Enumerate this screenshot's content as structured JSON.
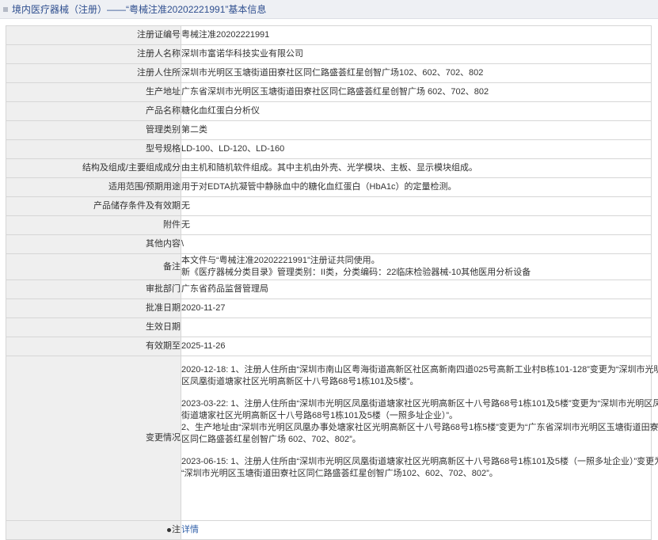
{
  "header": {
    "title": "境内医疗器械（注册）——“粤械注准20202221991”基本信息"
  },
  "rows": {
    "reg_no": {
      "label": "注册证编号",
      "value": "粤械注准20202221991"
    },
    "registrant": {
      "label": "注册人名称",
      "value": "深圳市富诺华科技实业有限公司"
    },
    "reg_address": {
      "label": "注册人住所",
      "value": "深圳市光明区玉塘街道田寮社区同仁路盛荟红星创智广场102、602、702、802"
    },
    "prod_address": {
      "label": "生产地址",
      "value": "广东省深圳市光明区玉塘街道田寮社区同仁路盛荟红星创智广场 602、702、802"
    },
    "product_name": {
      "label": "产品名称",
      "value": "糖化血红蛋白分析仪"
    },
    "category": {
      "label": "管理类别",
      "value": "第二类"
    },
    "model": {
      "label": "型号规格",
      "value": "LD-100、LD-120、LD-160"
    },
    "structure": {
      "label": "结构及组成/主要组成成分",
      "value": "由主机和随机软件组成。其中主机由外壳、光学模块、主板、显示模块组成。"
    },
    "scope": {
      "label": "适用范围/预期用途",
      "value": "用于对EDTA抗凝管中静脉血中的糖化血红蛋白（HbA1c）的定量检测。"
    },
    "storage": {
      "label": "产品储存条件及有效期",
      "value": "无"
    },
    "attachment": {
      "label": "附件",
      "value": "无"
    },
    "other": {
      "label": "其他内容",
      "value": "\\"
    },
    "remark": {
      "label": "备注",
      "line1": "本文件与“粤械注准20202221991”注册证共同使用。",
      "line2": "新《医疗器械分类目录》管理类别：II类，分类编码：22临床检验器械-10其他医用分析设备"
    },
    "approval_dept": {
      "label": "审批部门",
      "value": "广东省药品监督管理局"
    },
    "approval_date": {
      "label": "批准日期",
      "value": "2020-11-27"
    },
    "effective_date": {
      "label": "生效日期",
      "value": ""
    },
    "valid_until": {
      "label": "有效期至",
      "value": "2025-11-26"
    },
    "changes": {
      "label": "变更情况",
      "p1_l1": "2020-12-18: 1、注册人住所由“深圳市南山区粤海街道高新区社区高新南四道025号高新工业村B栋101-128”变更为“深圳市光明",
      "p1_l2": "区凤凰街道塘家社区光明高新区十八号路68号1栋101及5楼”。",
      "p2_l1": "2023-03-22: 1、注册人住所由“深圳市光明区凤凰街道塘家社区光明高新区十八号路68号1栋101及5楼”变更为“深圳市光明区凤凰",
      "p2_l2": "街道塘家社区光明高新区十八号路68号1栋101及5楼（一照多址企业）”。",
      "p2_l3": "2、生产地址由“深圳市光明区凤凰办事处塘家社区光明高新区十八号路68号1栋5楼”变更为“广东省深圳市光明区玉塘街道田寮社",
      "p2_l4": "区同仁路盛荟红星创智广场 602、702、802”。",
      "p3_l1": "2023-06-15: 1、注册人住所由“深圳市光明区凤凰街道塘家社区光明高新区十八号路68号1栋101及5楼（一照多址企业）”变更为",
      "p3_l2": "“深圳市光明区玉塘街道田寮社区同仁路盛荟红星创智广场102、602、702、802”。"
    },
    "note": {
      "label": "注",
      "value": "详情"
    }
  },
  "icons": {
    "header": "square-bullet-icon",
    "note": "dot-icon"
  },
  "colors": {
    "header_bg": "#eef0f4",
    "header_text": "#2f4f8f",
    "label_bg": "#efefef",
    "link": "#2f5fa8"
  }
}
